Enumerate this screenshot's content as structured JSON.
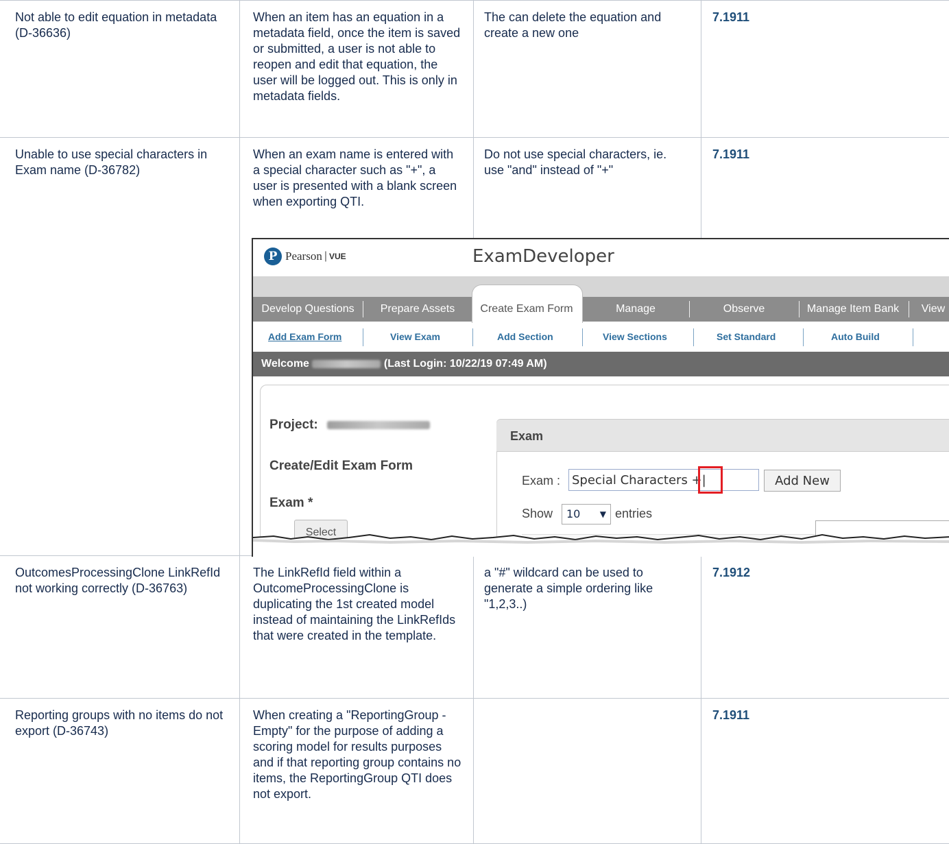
{
  "rows": [
    {
      "issue": "Not able to edit equation in metadata (D-36636)",
      "description": "When an item has an equation in a metadata field, once the item is saved or submitted, a user is not able to reopen and edit that equation, the user will be logged out. This is only in metadata fields.",
      "workaround": "The can delete the equation and create a new one",
      "version": "7.1911"
    },
    {
      "issue": "Unable to use special characters in Exam name (D-36782)",
      "description": "When an exam name is entered with a special character such as \"+\", a user is presented with a blank screen when exporting QTI.",
      "workaround": "Do not use special characters, ie. use \"and\" instead of \"+\"",
      "version": "7.1911"
    },
    {
      "issue": "OutcomesProcessingClone LinkRefId not working correctly (D-36763)",
      "description": "The LinkRefId field within a OutcomeProcessingClone is duplicating the 1st created model instead of maintaining the LinkRefIds that were created in the template.",
      "workaround": "a \"#\" wildcard can be used to generate a simple ordering like \"1,2,3..)",
      "version": "7.1912"
    },
    {
      "issue": "Reporting groups with no items do not export (D-36743)",
      "description": "When creating a \"ReportingGroup - Empty\" for the purpose of adding a scoring model for results purposes and if that reporting group contains no items, the ReportingGroup QTI does not export.",
      "workaround": "",
      "version": "7.1911"
    }
  ],
  "screenshot": {
    "brand": "Pearson",
    "brand_sep": "|",
    "brand_suffix": "VUE",
    "app_title": "ExamDeveloper",
    "nav": [
      "Develop Questions",
      "Prepare Assets",
      "Create Exam Form",
      "Manage",
      "Observe",
      "Manage Item Bank",
      "View"
    ],
    "subnav": [
      "Add Exam Form",
      "View Exam",
      "Add Section",
      "View Sections",
      "Set Standard",
      "Auto Build"
    ],
    "welcome_prefix": "Welcome",
    "welcome_suffix": "(Last Login: 10/22/19   07:49 AM)",
    "project_label": "Project:",
    "form_title": "Create/Edit Exam Form",
    "exam_required_label": "Exam *",
    "select_button": "Select",
    "exam_panel_title": "Exam",
    "exam_field_label": "Exam :",
    "exam_field_value": "Special Characters +|",
    "add_new_button": "Add New",
    "show_label": "Show",
    "show_value": "10",
    "entries_label": "entries",
    "highlight_color": "#e31e24"
  }
}
